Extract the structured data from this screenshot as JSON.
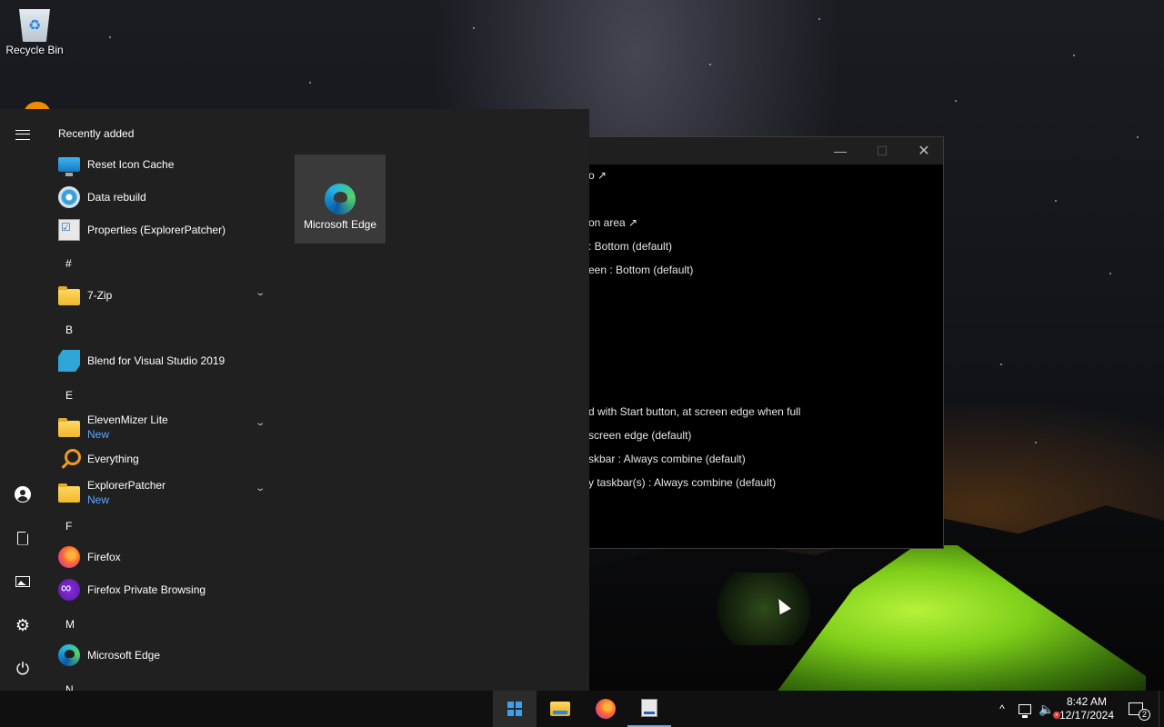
{
  "desktop": {
    "icons": [
      {
        "label": "Recycle Bin",
        "icon": "recycle-bin-icon"
      }
    ]
  },
  "background_window": {
    "controls": {
      "minimize": "—",
      "maximize": "☐",
      "close": "✕"
    },
    "lines": [
      "o ↗",
      "on area ↗",
      ": Bottom (default)",
      "een : Bottom (default)",
      "d with Start button, at screen edge when full",
      "screen edge (default)",
      "skbar : Always combine (default)",
      "y taskbar(s) : Always combine (default)"
    ]
  },
  "start_menu": {
    "rail": {
      "menu": "hamburger-icon",
      "user": "user-icon",
      "documents": "document-icon",
      "pictures": "pictures-icon",
      "settings": "⚙",
      "power": "⏻"
    },
    "recently_added_title": "Recently added",
    "recently_added": [
      {
        "name": "Reset Icon Cache",
        "icon": "monitor-icon"
      },
      {
        "name": "Data rebuild",
        "icon": "disc-icon"
      },
      {
        "name": "Properties (ExplorerPatcher)",
        "icon": "properties-icon"
      }
    ],
    "letters": {
      "hash": "#",
      "b": "B",
      "e": "E",
      "f": "F",
      "m": "M",
      "n": "N"
    },
    "apps": {
      "zip": {
        "name": "7-Zip",
        "icon": "folder-icon",
        "chevron": "⌄"
      },
      "blend": {
        "name": "Blend for Visual Studio 2019",
        "icon": "blend-icon"
      },
      "elevenmizer": {
        "name": "ElevenMizer Lite",
        "badge": "New",
        "icon": "folder-icon",
        "chevron": "⌄"
      },
      "everything": {
        "name": "Everything",
        "icon": "search-icon"
      },
      "explorerpatcher": {
        "name": "ExplorerPatcher",
        "badge": "New",
        "icon": "folder-icon",
        "chevron": "⌄"
      },
      "firefox": {
        "name": "Firefox",
        "icon": "firefox-icon"
      },
      "firefox_private": {
        "name": "Firefox Private Browsing",
        "icon": "firefox-private-icon"
      },
      "edge": {
        "name": "Microsoft Edge",
        "icon": "edge-icon"
      }
    },
    "tiles": [
      {
        "label": "Microsoft Edge",
        "icon": "edge-icon"
      }
    ]
  },
  "taskbar": {
    "pinned": [
      "windows-start-icon",
      "file-explorer-icon",
      "firefox-icon",
      "properties-icon"
    ],
    "tray": {
      "chevron": "^",
      "network": "network-icon",
      "volume": "🔈",
      "volume_muted_mark": "x",
      "time": "8:42 AM",
      "date": "12/17/2024",
      "notifications_count": "2"
    }
  }
}
